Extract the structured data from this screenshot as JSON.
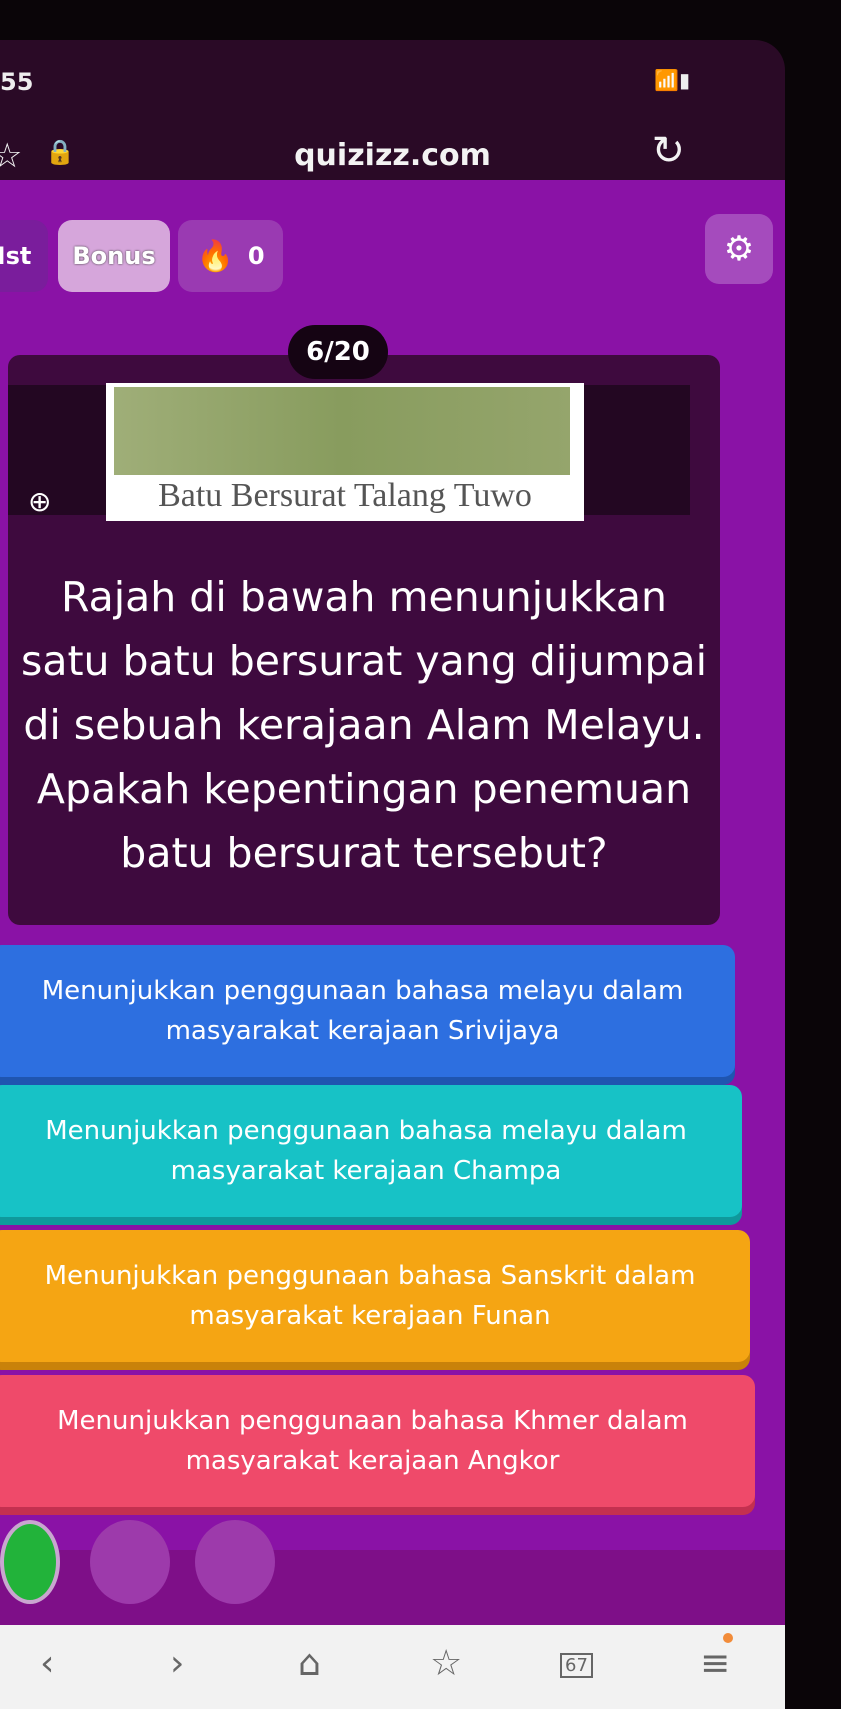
{
  "status": {
    "time": "55",
    "left_icons": "▲ ▣",
    "right_icons": "wifi signal battery"
  },
  "browser": {
    "url": "quizizz.com",
    "tab_count": "67"
  },
  "topbar": {
    "partial_tab": "Ist",
    "bonus_label": "Bonus",
    "streak_count": "0"
  },
  "question": {
    "counter": "6/20",
    "image_caption": "Batu Bersurat Talang Tuwo",
    "text": "Rajah di bawah menunjukkan satu batu bersurat yang dijumpai di sebuah kerajaan Alam Melayu. Apakah kepentingan penemuan batu bersurat tersebut?"
  },
  "options": [
    {
      "label": "Menunjukkan penggunaan bahasa melayu dalam masyarakat kerajaan Srivijaya",
      "color": "#2d6fe0"
    },
    {
      "label": "Menunjukkan penggunaan bahasa melayu dalam masyarakat kerajaan Champa",
      "color": "#17c2c6"
    },
    {
      "label": "Menunjukkan penggunaan bahasa Sanskrit dalam masyarakat kerajaan Funan",
      "color": "#f5a513"
    },
    {
      "label": "Menunjukkan penggunaan bahasa Khmer dalam masyarakat kerajaan Angkor",
      "color": "#ef4a6a"
    }
  ],
  "icons": {
    "back": "‹",
    "forward": "›",
    "home": "⌂",
    "bookmarks": "☆",
    "menu": "≡"
  },
  "colors": {
    "quiz_bg": "#8a12a6",
    "card_bg": "#3e0a3e"
  }
}
